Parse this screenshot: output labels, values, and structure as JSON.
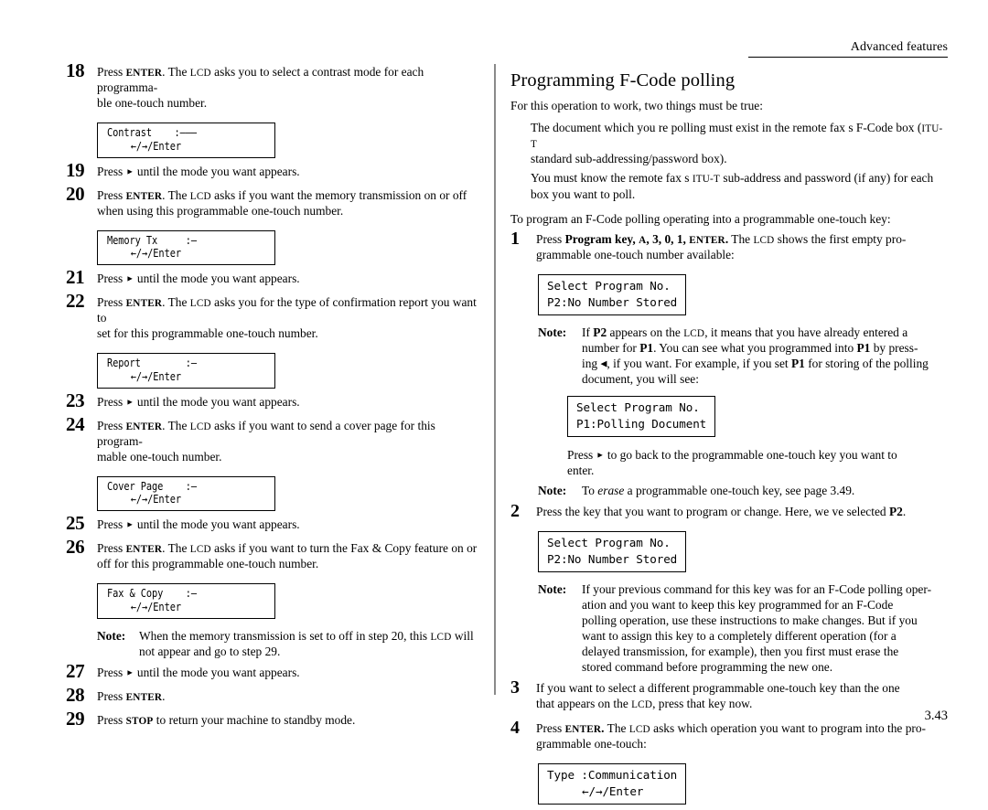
{
  "page": {
    "running_head": "Advanced features",
    "folio": "3.43"
  },
  "left_column": {
    "steps": [
      {
        "num": "18",
        "text_parts": [
          {
            "t": "Press ",
            "s": "n"
          },
          {
            "t": "ENTER",
            "s": "scb"
          },
          {
            "t": ". The ",
            "s": "n"
          },
          {
            "t": "LCD",
            "s": "sc"
          },
          {
            "t": " asks you to select a contrast mode for each programmable one-touch number.",
            "s": "n"
          }
        ],
        "plain": "Press ENTER. The LCD asks you to select a contrast mode for each programmable one-touch number.",
        "lcd": {
          "line1": "Contrast    :———",
          "line2": "←/→/Enter"
        }
      },
      {
        "num": "19",
        "plain": "Press ▸ until the mode you want appears."
      },
      {
        "num": "20",
        "plain": "Press ENTER. The LCD asks if you want the memory transmission on or off when using this programmable one-touch number.",
        "lcd": {
          "line1": "Memory Tx     :—",
          "line2": "←/→/Enter"
        }
      },
      {
        "num": "21",
        "plain": "Press ▸ until the mode you want appears."
      },
      {
        "num": "22",
        "plain": "Press ENTER. The LCD asks you for the type of confirmation report you want to set for this programmable one-touch number.",
        "lcd": {
          "line1": "Report        :—",
          "line2": "←/→/Enter"
        }
      },
      {
        "num": "23",
        "plain": "Press ▸ until the mode you want appears."
      },
      {
        "num": "24",
        "plain": "Press ENTER. The LCD asks if you want to send a cover page for this programmable one-touch number.",
        "lcd": {
          "line1": "Cover Page    :—",
          "line2": "←/→/Enter"
        }
      },
      {
        "num": "25",
        "plain": "Press ▸ until the mode you want appears."
      },
      {
        "num": "26",
        "plain": "Press ENTER. The LCD asks if you want to turn the Fax & Copy feature on or off for this programmable one-touch number.",
        "lcd": {
          "line1": "Fax & Copy    :—",
          "line2": "←/→/Enter"
        },
        "note": {
          "label": "Note:",
          "text": "When the memory transmission is set to off in step 20, this LCD will not appear and go to step 29."
        }
      },
      {
        "num": "27",
        "plain": "Press ▸ until the mode you want appears."
      },
      {
        "num": "28",
        "plain": "Press ENTER."
      },
      {
        "num": "29",
        "plain": "Press STOP to return your machine to standby mode."
      }
    ]
  },
  "right_column": {
    "heading": "Programming F-Code polling",
    "intro": "For this operation to work, two things must be true:",
    "conditions": [
      "The document which you re polling must exist in the remote fax s F-Code box (ITU-T standard sub-addressing/password box).",
      "You must know the remote fax s ITU-T sub-address and password (if any) for each box you want to poll."
    ],
    "lead": "To program an F-Code polling operating into a programmable one-touch key:",
    "steps": [
      {
        "num": "1",
        "plain": "Press Program key, A, 3, 0, 1, ENTER. The LCD shows the first empty programmable one-touch number available:",
        "lcd": {
          "line1": "Select Program No.",
          "line2": "P2:No Number Stored"
        },
        "note": {
          "label": "Note:",
          "text": "If P2 appears on the LCD, it means that you have already entered a number for P1. You can see what you programmed into P1 by pressing ◂, if you want. For example, if you set P1 for storing of the polling document, you will see:"
        },
        "note_lcd": {
          "line1": "Select Program No.",
          "line2": "P1:Polling Document"
        },
        "after_lcd": "Press ▸ to go back to the programmable one-touch key you want to enter.",
        "note2": {
          "label": "Note:",
          "text": "To erase a programmable one-touch key, see page 3.49."
        }
      },
      {
        "num": "2",
        "plain": "Press the key that you want to program or change. Here, we ve selected P2.",
        "lcd": {
          "line1": "Select Program No.",
          "line2": "P2:No Number Stored"
        },
        "note": {
          "label": "Note:",
          "text": "If your previous command for this key was for an F-Code polling operation and you want to keep this key programmed for an F-Code polling operation, use these instructions to make changes. But if you want to assign this key to a completely different operation (for a delayed transmission, for example), then you first must erase the stored command before programming the new one."
        }
      },
      {
        "num": "3",
        "plain": "If you want to select a different programmable one-touch key than the one that appears on the LCD, press that key now."
      },
      {
        "num": "4",
        "plain": "Press ENTER. The LCD asks which operation you want to program into the programmable one-touch:",
        "lcd": {
          "line1": "Type :Communication",
          "line2": "←/→/Enter"
        }
      }
    ]
  }
}
